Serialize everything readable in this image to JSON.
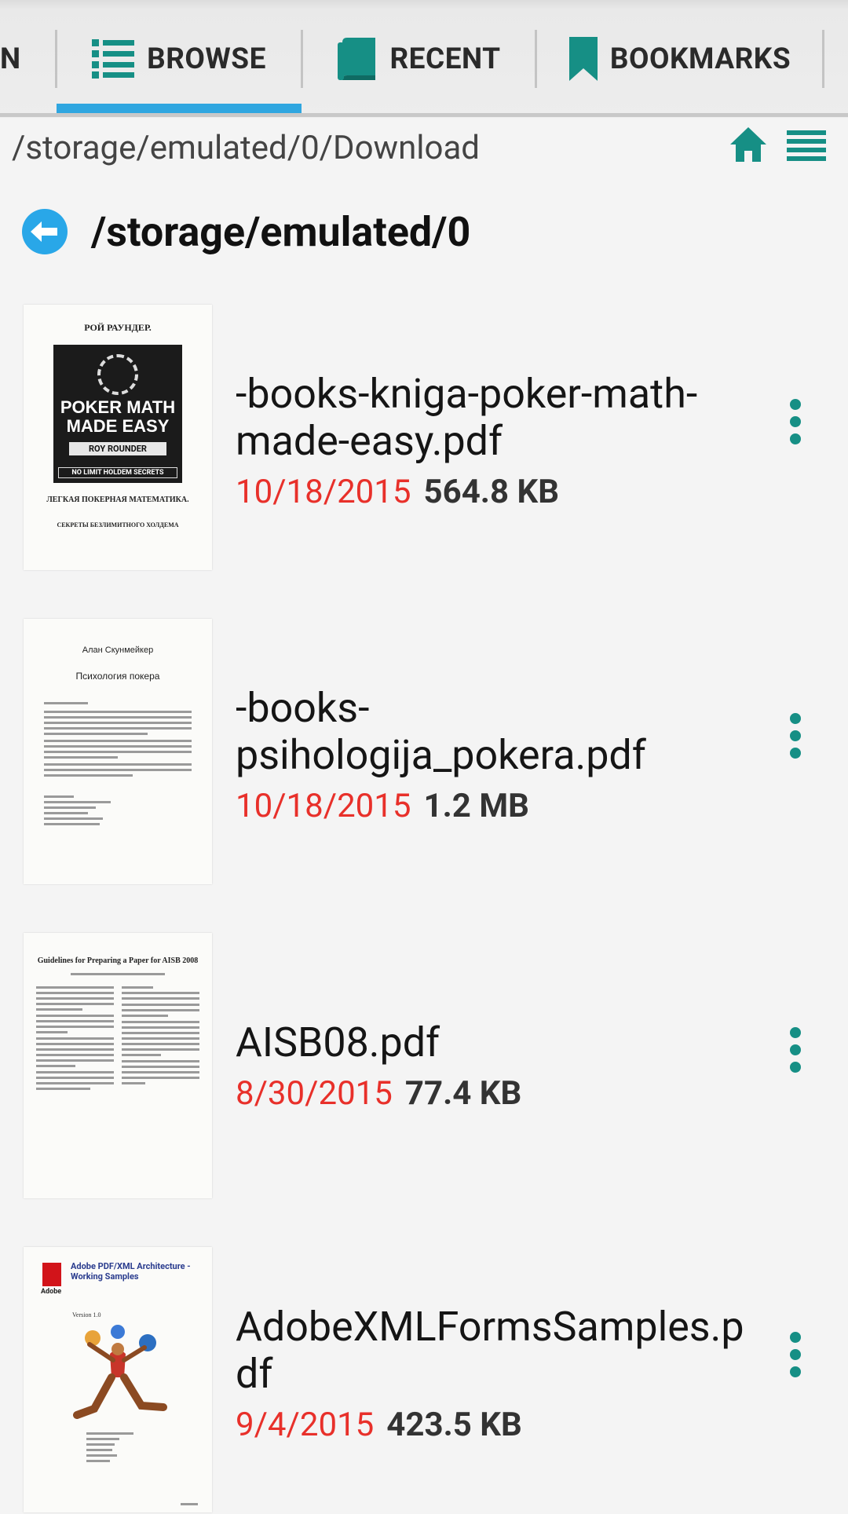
{
  "tabs": [
    {
      "label": "N",
      "icon": "partial-tab"
    },
    {
      "label": "BROWSE",
      "icon": "list-icon",
      "active": true
    },
    {
      "label": "RECENT",
      "icon": "book-icon"
    },
    {
      "label": "BOOKMARKS",
      "icon": "bookmark-icon"
    }
  ],
  "pathbar": {
    "path": "/storage/emulated/0/Download"
  },
  "parent": {
    "path": "/storage/emulated/0"
  },
  "files": [
    {
      "name": "-books-kniga-poker-math-made-easy.pdf",
      "date": "10/18/2015",
      "size": "564.8 KB",
      "thumb": {
        "author": "РОЙ РАУНДЕР.",
        "cover_title_1": "POKER MATH",
        "cover_title_2": "MADE EASY",
        "cover_author": "ROY ROUNDER",
        "cover_bar": "NO LIMIT HOLDEM SECRETS",
        "subtitle_ru": "ЛЕГКАЯ ПОКЕРНАЯ МАТЕМАТИКА.",
        "sub2_ru": "СЕКРЕТЫ БЕЗЛИМИТНОГО ХОЛДЕМА"
      }
    },
    {
      "name": "-books-psihologija_pokera.pdf",
      "date": "10/18/2015",
      "size": "1.2 MB",
      "thumb": {
        "author": "Алан Скунмейкер",
        "title": "Психология покера"
      }
    },
    {
      "name": "AISB08.pdf",
      "date": "8/30/2015",
      "size": "77.4 KB",
      "thumb": {
        "title": "Guidelines for Preparing a Paper for AISB 2008"
      }
    },
    {
      "name": "AdobeXMLFormsSamples.pdf",
      "date": "9/4/2015",
      "size": "423.5 KB",
      "thumb": {
        "title": "Adobe PDF/XML Architecture - Working Samples",
        "brand": "Adobe",
        "version": "Version 1.0"
      }
    }
  ],
  "colors": {
    "accent": "#2fa6e0",
    "date": "#e8302a",
    "icon": "#168f85",
    "back": "#29a7e8"
  }
}
